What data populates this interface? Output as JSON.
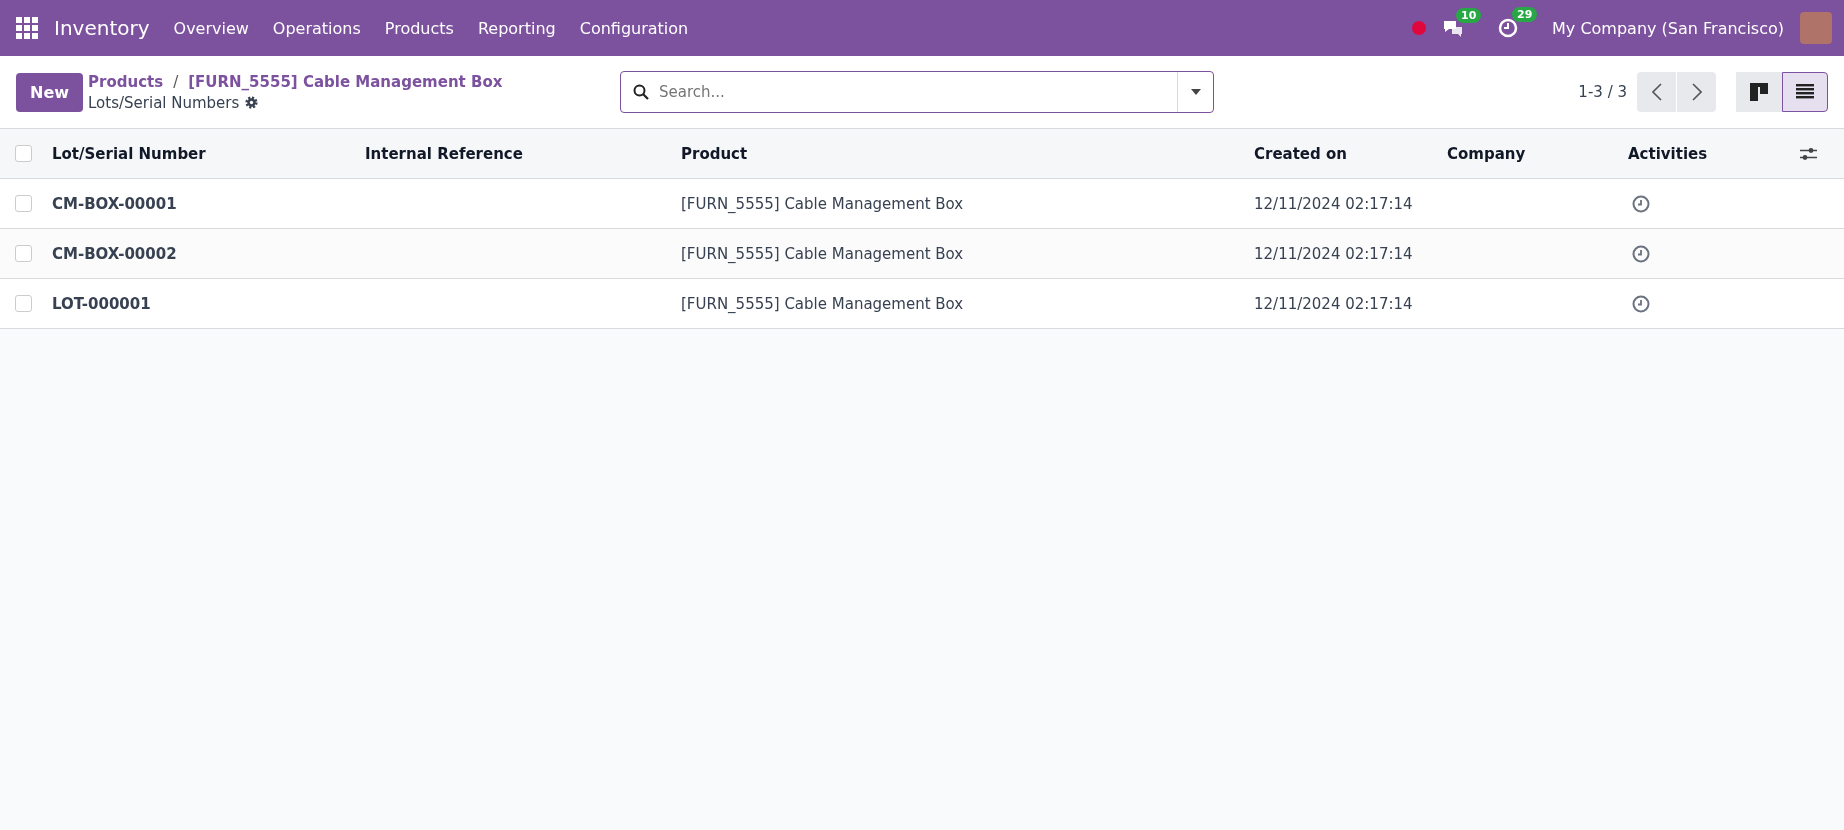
{
  "navbar": {
    "app_name": "Inventory",
    "menu": [
      "Overview",
      "Operations",
      "Products",
      "Reporting",
      "Configuration"
    ],
    "messages_count": "10",
    "activities_count": "29",
    "company": "My Company (San Francisco)"
  },
  "control_panel": {
    "new_button": "New",
    "breadcrumbs": [
      "Products",
      "[FURN_5555] Cable Management Box"
    ],
    "breadcrumb_separator": "/",
    "title": "Lots/Serial Numbers",
    "search": {
      "placeholder": "Search..."
    },
    "pager": "1-3 / 3",
    "views": [
      {
        "kind": "kanban",
        "selected": false
      },
      {
        "kind": "list",
        "selected": true
      }
    ]
  },
  "table": {
    "select_all_checked": false,
    "columns": [
      "Lot/Serial Number",
      "Internal Reference",
      "Product",
      "Created on",
      "Company",
      "Activities"
    ],
    "rows": [
      {
        "lot": "CM-BOX-00001",
        "product": "[FURN_5555] Cable Management Box",
        "created_on": "12/11/2024 02:17:14",
        "checked": false
      },
      {
        "lot": "CM-BOX-00002",
        "product": "[FURN_5555] Cable Management Box",
        "created_on": "12/11/2024 02:17:14",
        "checked": false
      },
      {
        "lot": "LOT-000001",
        "product": "[FURN_5555] Cable Management Box",
        "created_on": "12/11/2024 02:17:14",
        "checked": false
      }
    ]
  }
}
